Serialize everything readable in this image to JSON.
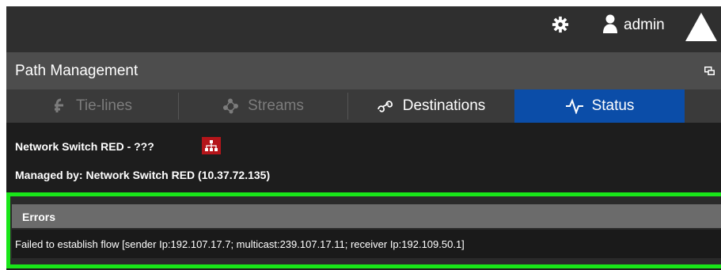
{
  "header": {
    "user": "admin",
    "icons": [
      "gear-icon",
      "user-icon",
      "alert-triangle-icon"
    ]
  },
  "panel": {
    "title": "Path Management"
  },
  "tabs": [
    {
      "label": "Tie-lines",
      "icon": "tie-lines-icon",
      "state": "disabled"
    },
    {
      "label": "Streams",
      "icon": "streams-icon",
      "state": "disabled"
    },
    {
      "label": "Destinations",
      "icon": "destinations-icon",
      "state": "enabled"
    },
    {
      "label": "Status",
      "icon": "status-pulse-icon",
      "state": "selected"
    }
  ],
  "device": {
    "name": "Network Switch RED - ???",
    "managed_by": "Managed by: Network Switch RED (10.37.72.135)"
  },
  "errors": {
    "title": "Errors",
    "message": "Failed to establish flow [sender Ip:192.107.17.7; multicast:239.107.17.11; receiver Ip:192.109.50.1]"
  },
  "colors": {
    "active_tab": "#0b4da8",
    "highlight_border": "#19e619",
    "device_badge": "#b4151a"
  }
}
